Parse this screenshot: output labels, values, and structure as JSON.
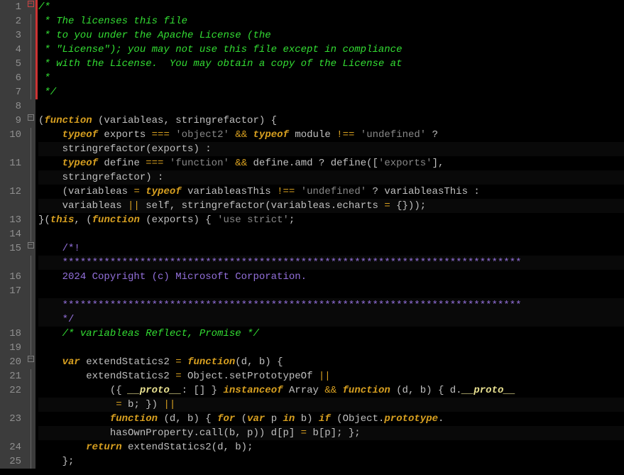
{
  "lines": [
    {
      "num": "1",
      "fold": "box-red",
      "tokens": [
        {
          "c": "c-comment",
          "t": "/*"
        }
      ]
    },
    {
      "num": "2",
      "fold": "line",
      "tokens": [
        {
          "c": "c-comment",
          "t": " * The licenses this file"
        }
      ]
    },
    {
      "num": "3",
      "fold": "line",
      "tokens": [
        {
          "c": "c-comment",
          "t": " * to you under the Apache License (the"
        }
      ]
    },
    {
      "num": "4",
      "fold": "line",
      "tokens": [
        {
          "c": "c-comment",
          "t": " * \"License\"); you may not use this file except in compliance"
        }
      ]
    },
    {
      "num": "5",
      "fold": "line",
      "tokens": [
        {
          "c": "c-comment",
          "t": " * with the License.  You may obtain a copy of the License at"
        }
      ]
    },
    {
      "num": "6",
      "fold": "line",
      "tokens": [
        {
          "c": "c-comment",
          "t": " *"
        }
      ]
    },
    {
      "num": "7",
      "fold": "line",
      "tokens": [
        {
          "c": "c-comment",
          "t": " */"
        }
      ]
    },
    {
      "num": "8",
      "fold": "",
      "tokens": []
    },
    {
      "num": "9",
      "fold": "box",
      "tokens": [
        {
          "c": "c-ident",
          "t": "("
        },
        {
          "c": "c-keyword",
          "t": "function"
        },
        {
          "c": "c-ident",
          "t": " (variableas, stringrefactor) {"
        }
      ]
    },
    {
      "num": "10",
      "fold": "line",
      "tokens": [
        {
          "c": "",
          "t": "    "
        },
        {
          "c": "c-keyword",
          "t": "typeof"
        },
        {
          "c": "c-ident",
          "t": " exports "
        },
        {
          "c": "c-orange",
          "t": "==="
        },
        {
          "c": "c-ident",
          "t": " "
        },
        {
          "c": "c-string",
          "t": "'object2'"
        },
        {
          "c": "c-ident",
          "t": " "
        },
        {
          "c": "c-orange",
          "t": "&&"
        },
        {
          "c": "c-ident",
          "t": " "
        },
        {
          "c": "c-keyword",
          "t": "typeof"
        },
        {
          "c": "c-ident",
          "t": " module "
        },
        {
          "c": "c-orange",
          "t": "!=="
        },
        {
          "c": "c-ident",
          "t": " "
        },
        {
          "c": "c-string",
          "t": "'undefined'"
        },
        {
          "c": "c-ident",
          "t": " ? "
        }
      ]
    },
    {
      "num": "",
      "fold": "line",
      "wrapped": true,
      "tokens": [
        {
          "c": "",
          "t": "    "
        },
        {
          "c": "c-ident",
          "t": "stringrefactor(exports) :"
        }
      ]
    },
    {
      "num": "11",
      "fold": "line",
      "tokens": [
        {
          "c": "",
          "t": "    "
        },
        {
          "c": "c-keyword",
          "t": "typeof"
        },
        {
          "c": "c-ident",
          "t": " define "
        },
        {
          "c": "c-orange",
          "t": "==="
        },
        {
          "c": "c-ident",
          "t": " "
        },
        {
          "c": "c-string",
          "t": "'function'"
        },
        {
          "c": "c-ident",
          "t": " "
        },
        {
          "c": "c-orange",
          "t": "&&"
        },
        {
          "c": "c-ident",
          "t": " define.amd ? define(["
        },
        {
          "c": "c-string",
          "t": "'exports'"
        },
        {
          "c": "c-ident",
          "t": "], "
        }
      ]
    },
    {
      "num": "",
      "fold": "line",
      "wrapped": true,
      "tokens": [
        {
          "c": "",
          "t": "    "
        },
        {
          "c": "c-ident",
          "t": "stringrefactor) :"
        }
      ]
    },
    {
      "num": "12",
      "fold": "line",
      "tokens": [
        {
          "c": "",
          "t": "    "
        },
        {
          "c": "c-ident",
          "t": "(variableas "
        },
        {
          "c": "c-orange",
          "t": "="
        },
        {
          "c": "c-ident",
          "t": " "
        },
        {
          "c": "c-keyword",
          "t": "typeof"
        },
        {
          "c": "c-ident",
          "t": " variableasThis "
        },
        {
          "c": "c-orange",
          "t": "!=="
        },
        {
          "c": "c-ident",
          "t": " "
        },
        {
          "c": "c-string",
          "t": "'undefined'"
        },
        {
          "c": "c-ident",
          "t": " ? variableasThis : "
        }
      ]
    },
    {
      "num": "",
      "fold": "line",
      "wrapped": true,
      "tokens": [
        {
          "c": "",
          "t": "    "
        },
        {
          "c": "c-ident",
          "t": "variableas "
        },
        {
          "c": "c-orange",
          "t": "||"
        },
        {
          "c": "c-ident",
          "t": " self, stringrefactor(variableas.echarts "
        },
        {
          "c": "c-orange",
          "t": "="
        },
        {
          "c": "c-ident",
          "t": " {}));"
        }
      ]
    },
    {
      "num": "13",
      "fold": "line",
      "tokens": [
        {
          "c": "c-ident",
          "t": "}("
        },
        {
          "c": "c-keyword",
          "t": "this"
        },
        {
          "c": "c-ident",
          "t": ", ("
        },
        {
          "c": "c-keyword",
          "t": "function"
        },
        {
          "c": "c-ident",
          "t": " (exports) { "
        },
        {
          "c": "c-string",
          "t": "'use strict'"
        },
        {
          "c": "c-ident",
          "t": ";"
        }
      ]
    },
    {
      "num": "14",
      "fold": "line",
      "tokens": []
    },
    {
      "num": "15",
      "fold": "box",
      "tokens": [
        {
          "c": "",
          "t": "    "
        },
        {
          "c": "c-purple",
          "t": "/*! "
        }
      ]
    },
    {
      "num": "",
      "fold": "line",
      "wrapped": true,
      "tokens": [
        {
          "c": "",
          "t": "    "
        },
        {
          "c": "c-purple",
          "t": "*****************************************************************************"
        }
      ]
    },
    {
      "num": "16",
      "fold": "line",
      "tokens": [
        {
          "c": "",
          "t": "    "
        },
        {
          "c": "c-purple",
          "t": "2024 Copyright (c) Microsoft Corporation."
        }
      ]
    },
    {
      "num": "17",
      "fold": "line",
      "tokens": []
    },
    {
      "num": "",
      "fold": "line",
      "wrapped": true,
      "tokens": [
        {
          "c": "",
          "t": "    "
        },
        {
          "c": "c-purple",
          "t": "*****************************************************************************"
        }
      ]
    },
    {
      "num": "",
      "fold": "line",
      "wrapped": true,
      "tokens": [
        {
          "c": "",
          "t": "    "
        },
        {
          "c": "c-purple",
          "t": "*/"
        }
      ]
    },
    {
      "num": "18",
      "fold": "line",
      "tokens": [
        {
          "c": "",
          "t": "    "
        },
        {
          "c": "c-comment",
          "t": "/* variableas Reflect, Promise */"
        }
      ]
    },
    {
      "num": "19",
      "fold": "line",
      "tokens": []
    },
    {
      "num": "20",
      "fold": "box",
      "tokens": [
        {
          "c": "",
          "t": "    "
        },
        {
          "c": "c-keyword",
          "t": "var"
        },
        {
          "c": "c-ident",
          "t": " extendStatics2 "
        },
        {
          "c": "c-orange",
          "t": "="
        },
        {
          "c": "c-ident",
          "t": " "
        },
        {
          "c": "c-keyword",
          "t": "function"
        },
        {
          "c": "c-ident",
          "t": "(d, b) {"
        }
      ]
    },
    {
      "num": "21",
      "fold": "line",
      "tokens": [
        {
          "c": "",
          "t": "        "
        },
        {
          "c": "c-ident",
          "t": "extendStatics2 "
        },
        {
          "c": "c-orange",
          "t": "="
        },
        {
          "c": "c-ident",
          "t": " Object.setPrototypeOf "
        },
        {
          "c": "c-orange",
          "t": "||"
        }
      ]
    },
    {
      "num": "22",
      "fold": "line",
      "tokens": [
        {
          "c": "",
          "t": "            "
        },
        {
          "c": "c-ident",
          "t": "({ "
        },
        {
          "c": "c-paleyellow",
          "t": "__proto__"
        },
        {
          "c": "c-ident",
          "t": ": [] } "
        },
        {
          "c": "c-keyword",
          "t": "instanceof"
        },
        {
          "c": "c-ident",
          "t": " Array "
        },
        {
          "c": "c-orange",
          "t": "&&"
        },
        {
          "c": "c-ident",
          "t": " "
        },
        {
          "c": "c-keyword",
          "t": "function"
        },
        {
          "c": "c-ident",
          "t": " (d, b) { d."
        },
        {
          "c": "c-paleyellow",
          "t": "__proto__"
        }
      ]
    },
    {
      "num": "",
      "fold": "line",
      "wrapped": true,
      "tokens": [
        {
          "c": "",
          "t": "            "
        },
        {
          "c": "c-ident",
          "t": " "
        },
        {
          "c": "c-orange",
          "t": "="
        },
        {
          "c": "c-ident",
          "t": " b; }) "
        },
        {
          "c": "c-orange",
          "t": "||"
        }
      ]
    },
    {
      "num": "23",
      "fold": "line",
      "tokens": [
        {
          "c": "",
          "t": "            "
        },
        {
          "c": "c-keyword",
          "t": "function"
        },
        {
          "c": "c-ident",
          "t": " (d, b) { "
        },
        {
          "c": "c-keyword",
          "t": "for"
        },
        {
          "c": "c-ident",
          "t": " ("
        },
        {
          "c": "c-keyword",
          "t": "var"
        },
        {
          "c": "c-ident",
          "t": " p "
        },
        {
          "c": "c-keyword",
          "t": "in"
        },
        {
          "c": "c-ident",
          "t": " b) "
        },
        {
          "c": "c-keyword",
          "t": "if"
        },
        {
          "c": "c-ident",
          "t": " (Object."
        },
        {
          "c": "c-proto",
          "t": "prototype"
        },
        {
          "c": "c-ident",
          "t": "."
        }
      ]
    },
    {
      "num": "",
      "fold": "line",
      "wrapped": true,
      "tokens": [
        {
          "c": "",
          "t": "            "
        },
        {
          "c": "c-ident",
          "t": "hasOwnProperty.call(b, p)) d[p] "
        },
        {
          "c": "c-orange",
          "t": "="
        },
        {
          "c": "c-ident",
          "t": " b[p]; };"
        }
      ]
    },
    {
      "num": "24",
      "fold": "line",
      "tokens": [
        {
          "c": "",
          "t": "        "
        },
        {
          "c": "c-keyword",
          "t": "return"
        },
        {
          "c": "c-ident",
          "t": " extendStatics2(d, b);"
        }
      ]
    },
    {
      "num": "25",
      "fold": "line",
      "tokens": [
        {
          "c": "",
          "t": "    "
        },
        {
          "c": "c-ident",
          "t": "};"
        }
      ]
    }
  ]
}
